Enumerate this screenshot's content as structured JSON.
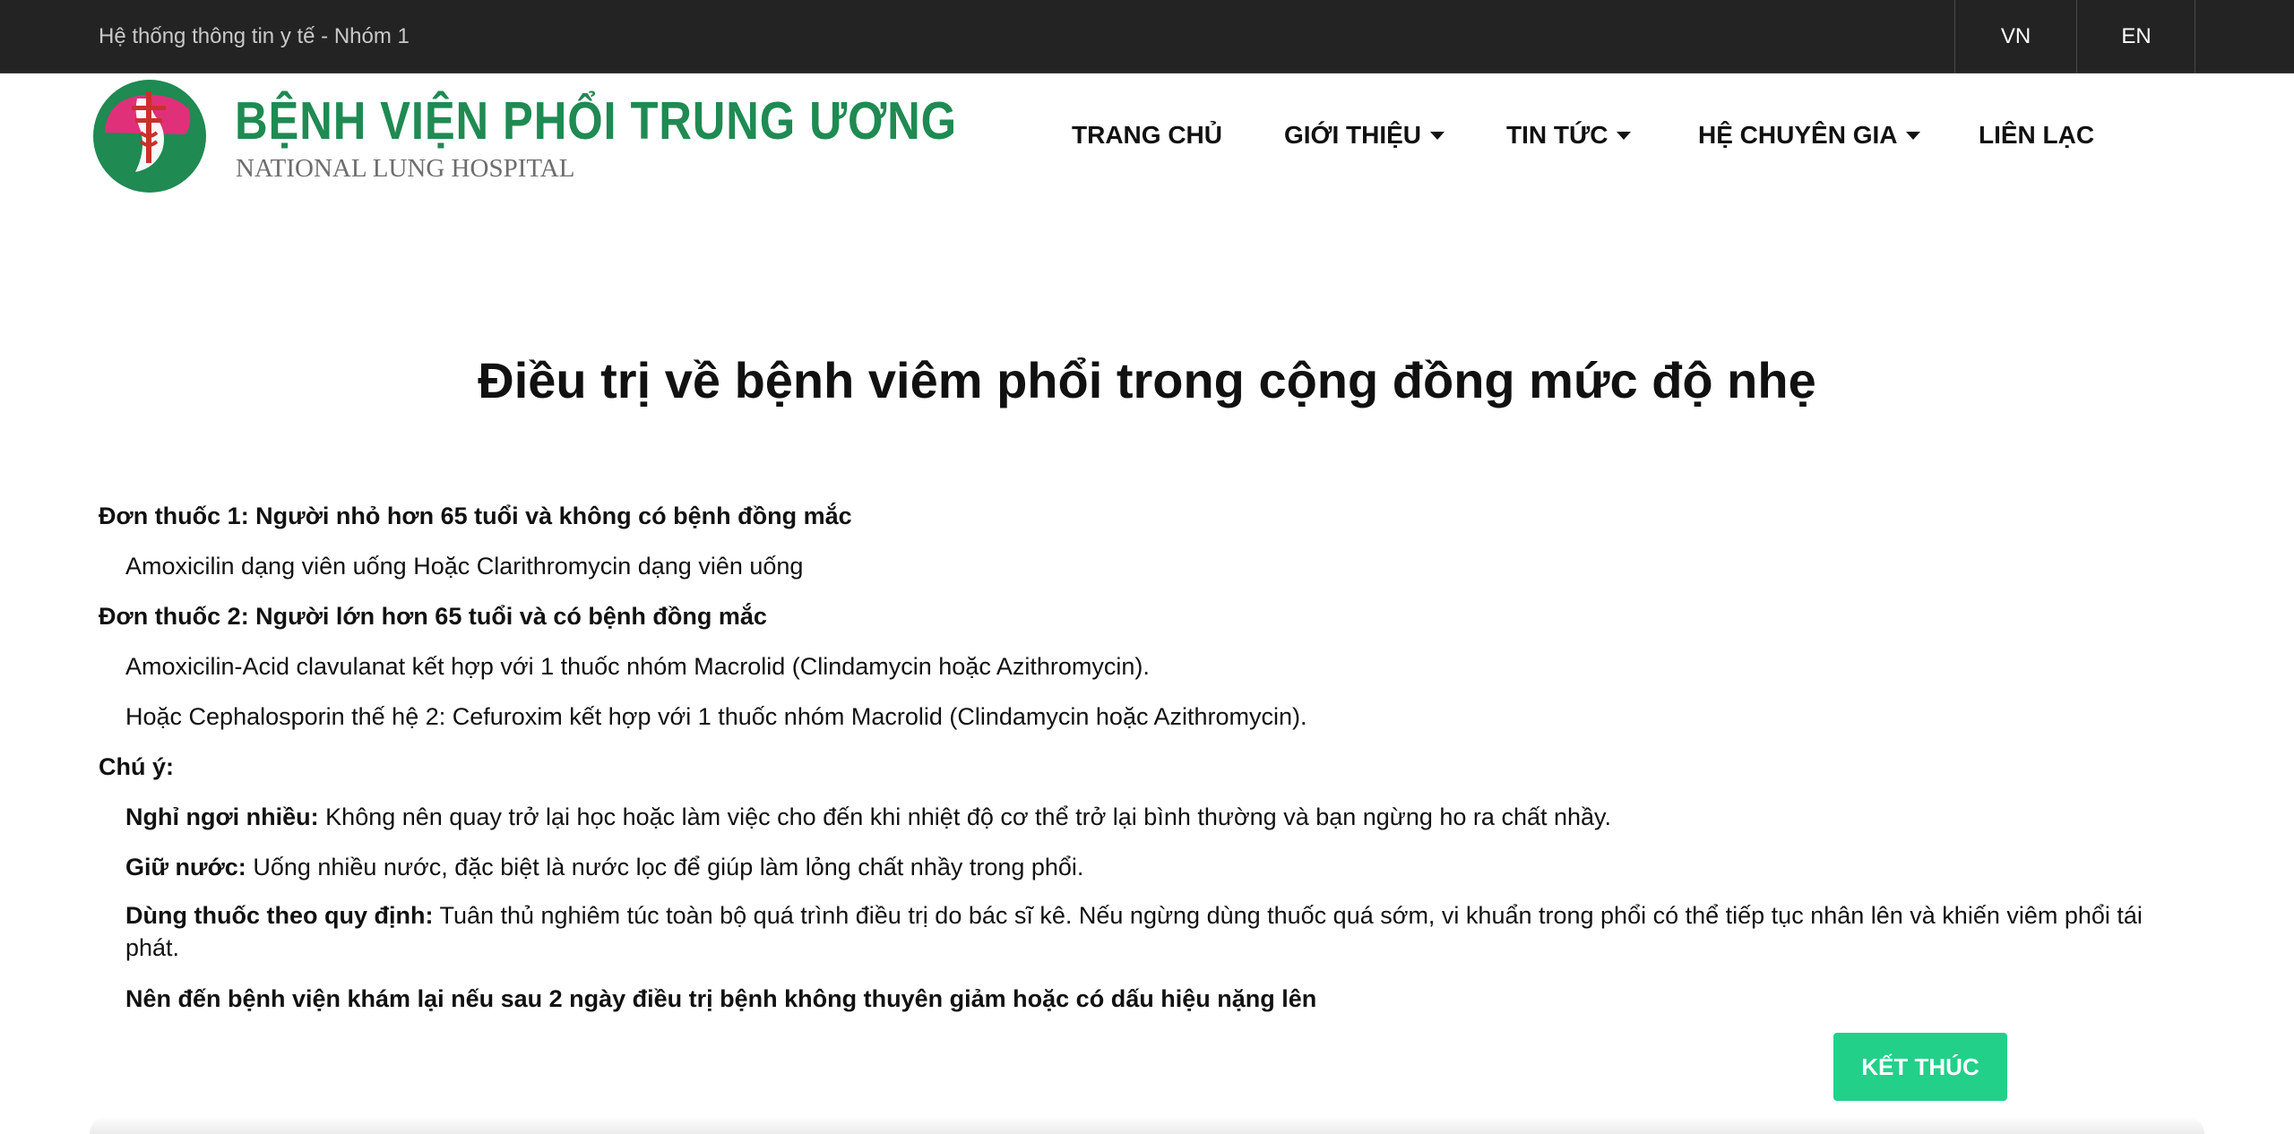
{
  "topbar": {
    "title": "Hệ thống thông tin y tế - Nhóm 1",
    "lang_vn": "VN",
    "lang_en": "EN"
  },
  "header": {
    "logo_name": "BỆNH VIỆN PHỔI TRUNG ƯƠNG",
    "logo_sub": "NATIONAL LUNG HOSPITAL",
    "nav": [
      {
        "label": "TRANG CHỦ",
        "dropdown": false
      },
      {
        "label": "GIỚI THIỆU",
        "dropdown": true
      },
      {
        "label": "TIN TỨC",
        "dropdown": true
      },
      {
        "label": "HỆ CHUYÊN GIA",
        "dropdown": true
      },
      {
        "label": "LIÊN LẠC",
        "dropdown": false
      }
    ]
  },
  "colors": {
    "topbar_bg": "#232323",
    "brand_green": "#1f8a52",
    "emblem_pink": "#e0307a",
    "button_green": "#22d08a"
  },
  "main": {
    "title": "Điều trị về bệnh viêm phổi trong cộng đồng mức độ nhẹ",
    "prescription1_heading": "Đơn thuốc 1: Người nhỏ hơn 65 tuổi và không có bệnh đồng mắc",
    "prescription1_text": "Amoxicilin dạng viên uống Hoặc Clarithromycin dạng viên uống",
    "prescription2_heading": "Đơn thuốc 2: Người lớn hơn 65 tuổi và có bệnh đồng mắc",
    "prescription2_text1": "Amoxicilin-Acid clavulanat kết hợp với 1 thuốc nhóm Macrolid (Clindamycin hoặc Azithromycin).",
    "prescription2_text2": "Hoặc Cephalosporin thế hệ 2: Cefuroxim kết hợp với 1 thuốc nhóm Macrolid (Clindamycin hoặc Azithromycin).",
    "note_heading": "Chú ý:",
    "notes": [
      {
        "label": "Nghỉ ngơi nhiều:",
        "text": " Không nên quay trở lại học hoặc làm việc cho đến khi nhiệt độ cơ thể trở lại bình thường và bạn ngừng ho ra chất nhầy."
      },
      {
        "label": "Giữ nước:",
        "text": " Uống nhiều nước, đặc biệt là nước lọc để giúp làm lỏng chất nhầy trong phổi."
      },
      {
        "label": "Dùng thuốc theo quy định:",
        "text": " Tuân thủ nghiêm túc toàn bộ quá trình điều trị do bác sĩ kê. Nếu ngừng dùng thuốc quá sớm, vi khuẩn trong phổi có thể tiếp tục nhân lên và khiến viêm phổi tái phát."
      }
    ],
    "final_note": "Nên đến bệnh viện khám lại nếu sau 2 ngày điều trị bệnh không thuyên giảm hoặc có dấu hiệu nặng lên",
    "finish_button": "KẾT THÚC"
  }
}
